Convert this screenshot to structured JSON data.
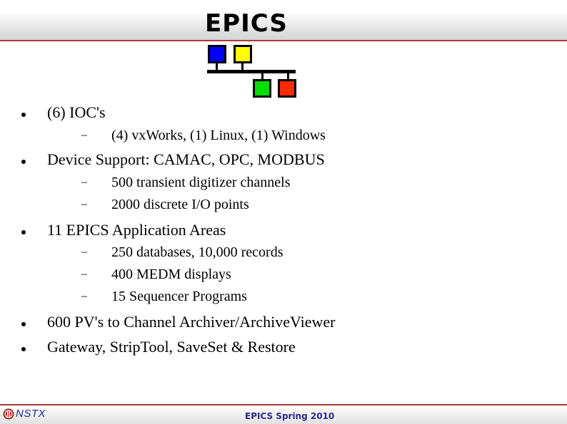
{
  "header": {
    "logo_text": "EPICS",
    "logo_icon": "network-nodes-icon",
    "node_colors": [
      "#0000ff",
      "#ffff00",
      "#00e000",
      "#ff2a00"
    ],
    "accent_color": "#a83c3c"
  },
  "content": {
    "items": [
      {
        "level": 1,
        "text": "(6)  IOC's"
      },
      {
        "level": 2,
        "text": "(4) vxWorks, (1) Linux, (1) Windows"
      },
      {
        "level": 1,
        "text": "Device Support: CAMAC, OPC, MODBUS"
      },
      {
        "level": 2,
        "text": "500 transient digitizer channels"
      },
      {
        "level": 2,
        "text": "2000 discrete I/O points"
      },
      {
        "level": 1,
        "text": "11 EPICS Application Areas"
      },
      {
        "level": 2,
        "text": "250 databases, 10,000 records"
      },
      {
        "level": 2,
        "text": "400 MEDM displays"
      },
      {
        "level": 2,
        "text": "15 Sequencer Programs"
      },
      {
        "level": 1,
        "text": "600 PV's to Channel Archiver/ArchiveViewer"
      },
      {
        "level": 1,
        "text": "Gateway, StripTool, SaveSet & Restore"
      }
    ],
    "dash_glyph": "–"
  },
  "footer": {
    "logo_text": "NSTX",
    "logo_icon": "nstx-logo-icon",
    "center_text": "EPICS Spring 2010"
  }
}
